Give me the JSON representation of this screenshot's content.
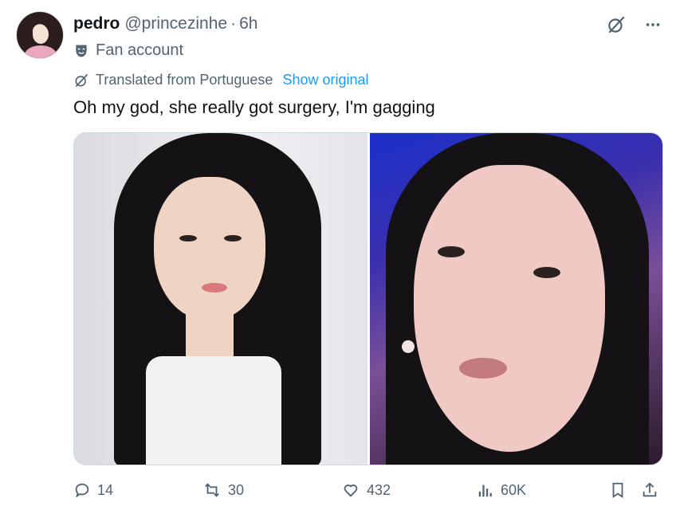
{
  "tweet": {
    "author_name": "pedro",
    "author_handle": "@princezinhe",
    "separator": "·",
    "time": "6h",
    "label": "Fan account",
    "translation": {
      "text": "Translated from Portuguese",
      "link": "Show original"
    },
    "text": "Oh my god, she really got surgery, I'm gagging"
  },
  "icons": {
    "label_icon": "theater-mask-icon",
    "translation_icon": "translate-icon",
    "grok_icon": "grok-icon",
    "more_icon": "more-icon",
    "reply_icon": "reply-icon",
    "retweet_icon": "retweet-icon",
    "like_icon": "heart-icon",
    "views_icon": "views-icon",
    "bookmark_icon": "bookmark-icon",
    "share_icon": "share-icon"
  },
  "actions": {
    "replies": "14",
    "retweets": "30",
    "likes": "432",
    "views": "60K"
  },
  "colors": {
    "link": "#1d9bf0",
    "secondary_text": "#536471",
    "primary_text": "#0f1419"
  }
}
